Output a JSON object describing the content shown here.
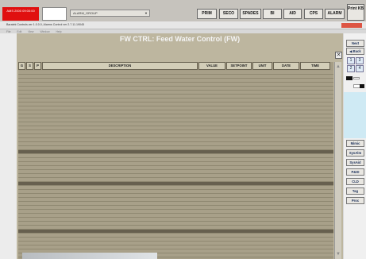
{
  "toolbar": {
    "alarm_block_text": "AMS 2000 09:00:00",
    "group_select": "ALARM_GROUP",
    "buttons": [
      "PRIM",
      "SECO",
      "SPADES",
      "BI",
      "AID",
      "CPS",
      "ALARM"
    ],
    "print_label": "Print KB"
  },
  "app": {
    "title": "Baratek Controls ver 1.0.0.0, Alarms Control ver 2.7.11.19045",
    "menu": [
      "File",
      "Edit",
      "View",
      "Window",
      "Help"
    ]
  },
  "panel": {
    "title": "FW CTRL: Feed Water Control (FW)",
    "close_glyph": "✕",
    "columns": [
      "G",
      "S",
      "P",
      "DESCRIPTION",
      "VALUE",
      "SETPOINT",
      "UNIT",
      "DATE",
      "TIME"
    ]
  },
  "sidebar": {
    "next": "Next",
    "back": "◀ Back",
    "nums": [
      "1",
      "3",
      "2",
      "4"
    ],
    "nav": [
      "Mimic",
      "SysAlm",
      "SysAid",
      "P&ID",
      "CLD",
      "Tag",
      "Proc"
    ]
  },
  "colors": {
    "alarm_red": "#e01010",
    "panel_bg": "#bdb69f",
    "row_bg": "#a8a089",
    "sidebar_accent": "#cfeaf4"
  }
}
